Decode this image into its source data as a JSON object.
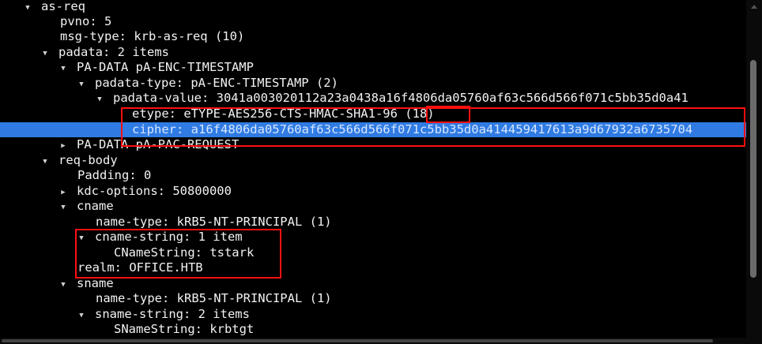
{
  "tree": {
    "rows": [
      {
        "arrow": "▼",
        "text": "as-req"
      },
      {
        "arrow": "",
        "text": "pvno: 5"
      },
      {
        "arrow": "",
        "text": "msg-type: krb-as-req (10)"
      },
      {
        "arrow": "▼",
        "text": "padata: 2 items"
      },
      {
        "arrow": "▼",
        "text": "PA-DATA pA-ENC-TIMESTAMP"
      },
      {
        "arrow": "▼",
        "text": "padata-type: pA-ENC-TIMESTAMP (2)"
      },
      {
        "arrow": "▼",
        "text": "padata-value: 3041a003020112a23a0438a16f4806da05760af63c566d566f071c5bb35d0a41"
      },
      {
        "arrow": "",
        "text": "etype: eTYPE-AES256-CTS-HMAC-SHA1-96 (18)"
      },
      {
        "arrow": "",
        "text": "cipher: a16f4806da05760af63c566d566f071c5bb35d0a414459417613a9d67932a6735704"
      },
      {
        "arrow": "▶",
        "text": "PA-DATA pA-PAC-REQUEST"
      },
      {
        "arrow": "▼",
        "text": "req-body"
      },
      {
        "arrow": "",
        "text": "Padding: 0"
      },
      {
        "arrow": "▶",
        "text": "kdc-options: 50800000"
      },
      {
        "arrow": "▼",
        "text": "cname"
      },
      {
        "arrow": "",
        "text": "name-type: kRB5-NT-PRINCIPAL (1)"
      },
      {
        "arrow": "▼",
        "text": "cname-string: 1 item"
      },
      {
        "arrow": "",
        "text": "CNameString: tstark"
      },
      {
        "arrow": "",
        "text": "realm: OFFICE.HTB"
      },
      {
        "arrow": "▼",
        "text": "sname"
      },
      {
        "arrow": "",
        "text": "name-type: kRB5-NT-PRINCIPAL (1)"
      },
      {
        "arrow": "▼",
        "text": "sname-string: 2 items"
      },
      {
        "arrow": "",
        "text": "SNameString: krbtgt"
      }
    ]
  },
  "colors": {
    "background": "#000000",
    "selection": "#2f7be3",
    "highlight_box": "#ff1010"
  }
}
